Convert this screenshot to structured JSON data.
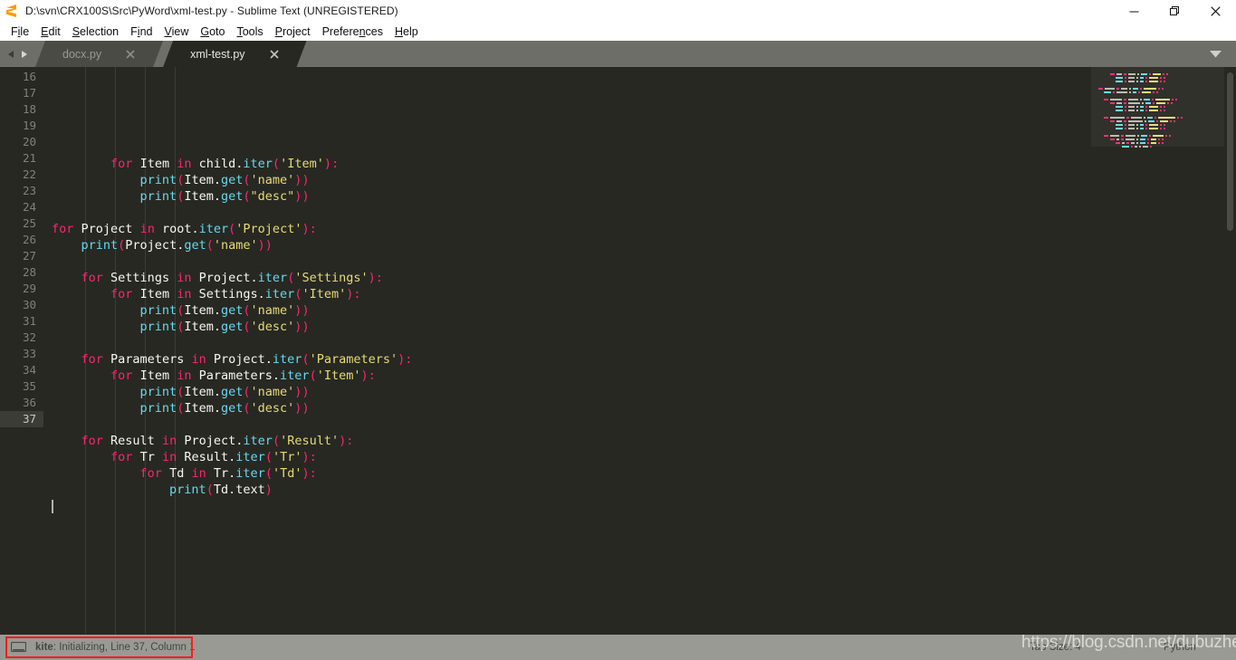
{
  "window": {
    "title": "D:\\svn\\CRX100S\\Src\\PyWord\\xml-test.py - Sublime Text (UNREGISTERED)",
    "logo_name": "sublime-text-logo",
    "controls": {
      "minimize": "minimize",
      "maximize": "maximize",
      "close": "close"
    }
  },
  "menubar": {
    "items": [
      {
        "label": "File",
        "pre": "F",
        "accel": "i",
        "post": "le"
      },
      {
        "label": "Edit",
        "pre": "",
        "accel": "E",
        "post": "dit"
      },
      {
        "label": "Selection",
        "pre": "",
        "accel": "S",
        "post": "election"
      },
      {
        "label": "Find",
        "pre": "F",
        "accel": "i",
        "post": "nd"
      },
      {
        "label": "View",
        "pre": "",
        "accel": "V",
        "post": "iew"
      },
      {
        "label": "Goto",
        "pre": "",
        "accel": "G",
        "post": "oto"
      },
      {
        "label": "Tools",
        "pre": "",
        "accel": "T",
        "post": "ools"
      },
      {
        "label": "Project",
        "pre": "",
        "accel": "P",
        "post": "roject"
      },
      {
        "label": "Preferences",
        "pre": "Prefere",
        "accel": "n",
        "post": "ces"
      },
      {
        "label": "Help",
        "pre": "",
        "accel": "H",
        "post": "elp"
      }
    ]
  },
  "tabbar": {
    "nav_prev": "prev-tab-arrow",
    "nav_next": "next-tab-arrow",
    "tabs": [
      {
        "label": "docx.py",
        "active": false
      },
      {
        "label": "xml-test.py",
        "active": true
      }
    ],
    "overflow_menu": "tab-overflow-chevron"
  },
  "editor": {
    "first_line_number": 16,
    "cursor_line": 37,
    "lines": [
      {
        "n": 16,
        "tokens": [
          {
            "t": "        ",
            "c": "p"
          },
          {
            "t": "for",
            "c": "k"
          },
          {
            "t": " ",
            "c": "p"
          },
          {
            "t": "Item",
            "c": "p"
          },
          {
            "t": " ",
            "c": "p"
          },
          {
            "t": "in",
            "c": "k"
          },
          {
            "t": " ",
            "c": "p"
          },
          {
            "t": "child",
            "c": "p"
          },
          {
            "t": ".",
            "c": "d"
          },
          {
            "t": "iter",
            "c": "fn"
          },
          {
            "t": "(",
            "c": "op"
          },
          {
            "t": "'Item'",
            "c": "s"
          },
          {
            "t": ")",
            "c": "op"
          },
          {
            "t": ":",
            "c": "op"
          }
        ]
      },
      {
        "n": 17,
        "tokens": [
          {
            "t": "            ",
            "c": "p"
          },
          {
            "t": "print",
            "c": "fn"
          },
          {
            "t": "(",
            "c": "op"
          },
          {
            "t": "Item",
            "c": "p"
          },
          {
            "t": ".",
            "c": "d"
          },
          {
            "t": "get",
            "c": "fn"
          },
          {
            "t": "(",
            "c": "op"
          },
          {
            "t": "'name'",
            "c": "s"
          },
          {
            "t": ")",
            "c": "op"
          },
          {
            "t": ")",
            "c": "op"
          }
        ]
      },
      {
        "n": 18,
        "tokens": [
          {
            "t": "            ",
            "c": "p"
          },
          {
            "t": "print",
            "c": "fn"
          },
          {
            "t": "(",
            "c": "op"
          },
          {
            "t": "Item",
            "c": "p"
          },
          {
            "t": ".",
            "c": "d"
          },
          {
            "t": "get",
            "c": "fn"
          },
          {
            "t": "(",
            "c": "op"
          },
          {
            "t": "\"desc\"",
            "c": "s"
          },
          {
            "t": ")",
            "c": "op"
          },
          {
            "t": ")",
            "c": "op"
          }
        ]
      },
      {
        "n": 19,
        "tokens": []
      },
      {
        "n": 20,
        "tokens": [
          {
            "t": "for",
            "c": "k"
          },
          {
            "t": " ",
            "c": "p"
          },
          {
            "t": "Project",
            "c": "p"
          },
          {
            "t": " ",
            "c": "p"
          },
          {
            "t": "in",
            "c": "k"
          },
          {
            "t": " ",
            "c": "p"
          },
          {
            "t": "root",
            "c": "p"
          },
          {
            "t": ".",
            "c": "d"
          },
          {
            "t": "iter",
            "c": "fn"
          },
          {
            "t": "(",
            "c": "op"
          },
          {
            "t": "'Project'",
            "c": "s"
          },
          {
            "t": ")",
            "c": "op"
          },
          {
            "t": ":",
            "c": "op"
          }
        ]
      },
      {
        "n": 21,
        "tokens": [
          {
            "t": "    ",
            "c": "p"
          },
          {
            "t": "print",
            "c": "fn"
          },
          {
            "t": "(",
            "c": "op"
          },
          {
            "t": "Project",
            "c": "p"
          },
          {
            "t": ".",
            "c": "d"
          },
          {
            "t": "get",
            "c": "fn"
          },
          {
            "t": "(",
            "c": "op"
          },
          {
            "t": "'name'",
            "c": "s"
          },
          {
            "t": ")",
            "c": "op"
          },
          {
            "t": ")",
            "c": "op"
          }
        ]
      },
      {
        "n": 22,
        "tokens": []
      },
      {
        "n": 23,
        "tokens": [
          {
            "t": "    ",
            "c": "p"
          },
          {
            "t": "for",
            "c": "k"
          },
          {
            "t": " ",
            "c": "p"
          },
          {
            "t": "Settings",
            "c": "p"
          },
          {
            "t": " ",
            "c": "p"
          },
          {
            "t": "in",
            "c": "k"
          },
          {
            "t": " ",
            "c": "p"
          },
          {
            "t": "Project",
            "c": "p"
          },
          {
            "t": ".",
            "c": "d"
          },
          {
            "t": "iter",
            "c": "fn"
          },
          {
            "t": "(",
            "c": "op"
          },
          {
            "t": "'Settings'",
            "c": "s"
          },
          {
            "t": ")",
            "c": "op"
          },
          {
            "t": ":",
            "c": "op"
          }
        ]
      },
      {
        "n": 24,
        "tokens": [
          {
            "t": "        ",
            "c": "p"
          },
          {
            "t": "for",
            "c": "k"
          },
          {
            "t": " ",
            "c": "p"
          },
          {
            "t": "Item",
            "c": "p"
          },
          {
            "t": " ",
            "c": "p"
          },
          {
            "t": "in",
            "c": "k"
          },
          {
            "t": " ",
            "c": "p"
          },
          {
            "t": "Settings",
            "c": "p"
          },
          {
            "t": ".",
            "c": "d"
          },
          {
            "t": "iter",
            "c": "fn"
          },
          {
            "t": "(",
            "c": "op"
          },
          {
            "t": "'Item'",
            "c": "s"
          },
          {
            "t": ")",
            "c": "op"
          },
          {
            "t": ":",
            "c": "op"
          }
        ]
      },
      {
        "n": 25,
        "tokens": [
          {
            "t": "            ",
            "c": "p"
          },
          {
            "t": "print",
            "c": "fn"
          },
          {
            "t": "(",
            "c": "op"
          },
          {
            "t": "Item",
            "c": "p"
          },
          {
            "t": ".",
            "c": "d"
          },
          {
            "t": "get",
            "c": "fn"
          },
          {
            "t": "(",
            "c": "op"
          },
          {
            "t": "'name'",
            "c": "s"
          },
          {
            "t": ")",
            "c": "op"
          },
          {
            "t": ")",
            "c": "op"
          }
        ]
      },
      {
        "n": 26,
        "tokens": [
          {
            "t": "            ",
            "c": "p"
          },
          {
            "t": "print",
            "c": "fn"
          },
          {
            "t": "(",
            "c": "op"
          },
          {
            "t": "Item",
            "c": "p"
          },
          {
            "t": ".",
            "c": "d"
          },
          {
            "t": "get",
            "c": "fn"
          },
          {
            "t": "(",
            "c": "op"
          },
          {
            "t": "'desc'",
            "c": "s"
          },
          {
            "t": ")",
            "c": "op"
          },
          {
            "t": ")",
            "c": "op"
          }
        ]
      },
      {
        "n": 27,
        "tokens": []
      },
      {
        "n": 28,
        "tokens": [
          {
            "t": "    ",
            "c": "p"
          },
          {
            "t": "for",
            "c": "k"
          },
          {
            "t": " ",
            "c": "p"
          },
          {
            "t": "Parameters",
            "c": "p"
          },
          {
            "t": " ",
            "c": "p"
          },
          {
            "t": "in",
            "c": "k"
          },
          {
            "t": " ",
            "c": "p"
          },
          {
            "t": "Project",
            "c": "p"
          },
          {
            "t": ".",
            "c": "d"
          },
          {
            "t": "iter",
            "c": "fn"
          },
          {
            "t": "(",
            "c": "op"
          },
          {
            "t": "'Parameters'",
            "c": "s"
          },
          {
            "t": ")",
            "c": "op"
          },
          {
            "t": ":",
            "c": "op"
          }
        ]
      },
      {
        "n": 29,
        "tokens": [
          {
            "t": "        ",
            "c": "p"
          },
          {
            "t": "for",
            "c": "k"
          },
          {
            "t": " ",
            "c": "p"
          },
          {
            "t": "Item",
            "c": "p"
          },
          {
            "t": " ",
            "c": "p"
          },
          {
            "t": "in",
            "c": "k"
          },
          {
            "t": " ",
            "c": "p"
          },
          {
            "t": "Parameters",
            "c": "p"
          },
          {
            "t": ".",
            "c": "d"
          },
          {
            "t": "iter",
            "c": "fn"
          },
          {
            "t": "(",
            "c": "op"
          },
          {
            "t": "'Item'",
            "c": "s"
          },
          {
            "t": ")",
            "c": "op"
          },
          {
            "t": ":",
            "c": "op"
          }
        ]
      },
      {
        "n": 30,
        "tokens": [
          {
            "t": "            ",
            "c": "p"
          },
          {
            "t": "print",
            "c": "fn"
          },
          {
            "t": "(",
            "c": "op"
          },
          {
            "t": "Item",
            "c": "p"
          },
          {
            "t": ".",
            "c": "d"
          },
          {
            "t": "get",
            "c": "fn"
          },
          {
            "t": "(",
            "c": "op"
          },
          {
            "t": "'name'",
            "c": "s"
          },
          {
            "t": ")",
            "c": "op"
          },
          {
            "t": ")",
            "c": "op"
          }
        ]
      },
      {
        "n": 31,
        "tokens": [
          {
            "t": "            ",
            "c": "p"
          },
          {
            "t": "print",
            "c": "fn"
          },
          {
            "t": "(",
            "c": "op"
          },
          {
            "t": "Item",
            "c": "p"
          },
          {
            "t": ".",
            "c": "d"
          },
          {
            "t": "get",
            "c": "fn"
          },
          {
            "t": "(",
            "c": "op"
          },
          {
            "t": "'desc'",
            "c": "s"
          },
          {
            "t": ")",
            "c": "op"
          },
          {
            "t": ")",
            "c": "op"
          }
        ]
      },
      {
        "n": 32,
        "tokens": []
      },
      {
        "n": 33,
        "tokens": [
          {
            "t": "    ",
            "c": "p"
          },
          {
            "t": "for",
            "c": "k"
          },
          {
            "t": " ",
            "c": "p"
          },
          {
            "t": "Result",
            "c": "p"
          },
          {
            "t": " ",
            "c": "p"
          },
          {
            "t": "in",
            "c": "k"
          },
          {
            "t": " ",
            "c": "p"
          },
          {
            "t": "Project",
            "c": "p"
          },
          {
            "t": ".",
            "c": "d"
          },
          {
            "t": "iter",
            "c": "fn"
          },
          {
            "t": "(",
            "c": "op"
          },
          {
            "t": "'Result'",
            "c": "s"
          },
          {
            "t": ")",
            "c": "op"
          },
          {
            "t": ":",
            "c": "op"
          }
        ]
      },
      {
        "n": 34,
        "tokens": [
          {
            "t": "        ",
            "c": "p"
          },
          {
            "t": "for",
            "c": "k"
          },
          {
            "t": " ",
            "c": "p"
          },
          {
            "t": "Tr",
            "c": "p"
          },
          {
            "t": " ",
            "c": "p"
          },
          {
            "t": "in",
            "c": "k"
          },
          {
            "t": " ",
            "c": "p"
          },
          {
            "t": "Result",
            "c": "p"
          },
          {
            "t": ".",
            "c": "d"
          },
          {
            "t": "iter",
            "c": "fn"
          },
          {
            "t": "(",
            "c": "op"
          },
          {
            "t": "'Tr'",
            "c": "s"
          },
          {
            "t": ")",
            "c": "op"
          },
          {
            "t": ":",
            "c": "op"
          }
        ]
      },
      {
        "n": 35,
        "tokens": [
          {
            "t": "            ",
            "c": "p"
          },
          {
            "t": "for",
            "c": "k"
          },
          {
            "t": " ",
            "c": "p"
          },
          {
            "t": "Td",
            "c": "p"
          },
          {
            "t": " ",
            "c": "p"
          },
          {
            "t": "in",
            "c": "k"
          },
          {
            "t": " ",
            "c": "p"
          },
          {
            "t": "Tr",
            "c": "p"
          },
          {
            "t": ".",
            "c": "d"
          },
          {
            "t": "iter",
            "c": "fn"
          },
          {
            "t": "(",
            "c": "op"
          },
          {
            "t": "'Td'",
            "c": "s"
          },
          {
            "t": ")",
            "c": "op"
          },
          {
            "t": ":",
            "c": "op"
          }
        ]
      },
      {
        "n": 36,
        "tokens": [
          {
            "t": "                ",
            "c": "p"
          },
          {
            "t": "print",
            "c": "fn"
          },
          {
            "t": "(",
            "c": "op"
          },
          {
            "t": "Td",
            "c": "p"
          },
          {
            "t": ".",
            "c": "d"
          },
          {
            "t": "text",
            "c": "p"
          },
          {
            "t": ")",
            "c": "op"
          }
        ]
      },
      {
        "n": 37,
        "tokens": []
      }
    ]
  },
  "minimap": {
    "name": "code-minimap"
  },
  "scrollbar": {
    "name": "vertical-scrollbar"
  },
  "statusbar": {
    "icon": "monitor-icon",
    "kite_prefix": "kite",
    "kite_message": ": Initializing, Line 37, Column 1",
    "tab_size": "Tab Size: 4",
    "language": "Python"
  },
  "overlay": {
    "watermark": "https://blog.csdn.net/dubuzherui",
    "annotation_box": "status-bar-highlight"
  },
  "colors": {
    "editor_bg": "#272822",
    "keyword": "#f92672",
    "function": "#66d9ef",
    "string": "#e6db74",
    "plain": "#f8f8f2",
    "gutter_text": "#81817a",
    "tabbar_bg": "#6e6e68",
    "statusbar_bg": "#9a9a94",
    "annotation_red": "#fd1e1e"
  }
}
